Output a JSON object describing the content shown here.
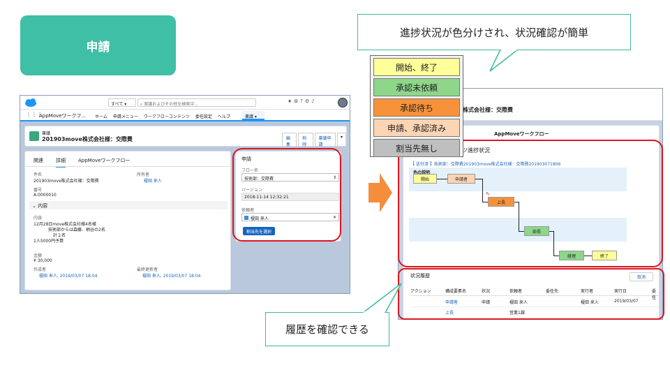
{
  "badge": {
    "label": "申請"
  },
  "callout_top": {
    "text": "進捗状況が色分けされ、状況確認が簡単"
  },
  "callout_bottom": {
    "text": "履歴を確認できる"
  },
  "legend": {
    "items": [
      {
        "label": "開始、終了",
        "color": "#ffff99"
      },
      {
        "label": "承認未依頼",
        "color": "#8ed68a"
      },
      {
        "label": "承認待ち",
        "color": "#f7923a"
      },
      {
        "label": "申請、承認済み",
        "color": "#fcd5b4"
      },
      {
        "label": "割当先無し",
        "color": "#bfbfbf"
      }
    ]
  },
  "left": {
    "search": {
      "scope": "すべて",
      "placeholder": "案議およびその他を検索中..."
    },
    "nav": {
      "app": "AppMoveワークフ...",
      "items": [
        "ホーム",
        "申請メニュー",
        "ワークフローコンテンツ",
        "委任設定",
        "ヘルプ"
      ],
      "active": "稟議"
    },
    "record": {
      "type": "稟議",
      "title": "201903move株式会社様：交際費",
      "actions": [
        "編集",
        "削除",
        "稟議申請"
      ]
    },
    "tabs": [
      "関連",
      "詳細",
      "AppMoveワークフロー"
    ],
    "active_tab": "詳細",
    "fields": {
      "name_label": "件名",
      "name_value": "201903move株式会社様：交際費",
      "owner_label": "所有者",
      "owner_value": "榎田 来人",
      "number_label": "番号",
      "number_value": "A-0000010",
      "section": "内容",
      "content_label": "内容",
      "content_lines": [
        "12月28日move株式会社様4名様",
        "技術部からは森藤、柄谷の2名",
        "計２名",
        "1人5000円予算"
      ],
      "amount_label": "金額",
      "amount_value": "¥ 30,000",
      "creator_label": "作成者",
      "creator_value": "榎田 来人, 2019/03/07 18:04",
      "modifier_label": "最終更新者",
      "modifier_value": "榎田 来人, 2019/03/07 18:04"
    },
    "apply_panel": {
      "title": "申請",
      "flow_label": "フロー名",
      "flow_value": "技術部：交際費",
      "version_label": "バージョン",
      "version_value": "2018-11-14 12:32:21",
      "approver_label": "依頼者",
      "approver_value": "榎田 来人",
      "button": "割当先を選択"
    }
  },
  "right": {
    "title": "株式会社様：交際費",
    "section_title": "AppMoveワークフロー",
    "progress_title": "ツ進捗状況",
    "path": "【 送付済 】技術部：交際費201903move株式会社様：交際費201903071806",
    "legend_label": "色の説明",
    "nodes": [
      "開始",
      "申請者",
      "上長",
      "部長",
      "経理",
      "終了"
    ],
    "history_title": "状況履歴",
    "cancel": "取消",
    "columns": [
      "アクション",
      "構成要素名",
      "状況",
      "依頼者",
      "委任先",
      "実行者",
      "実行日",
      "委任"
    ],
    "rows": [
      [
        "",
        "申請者",
        "申請",
        "榎田 来人",
        "",
        "榎田 来人",
        "2019/03/07",
        ""
      ],
      [
        "",
        "上長",
        "",
        "営業1課",
        "",
        "",
        "",
        ""
      ]
    ]
  }
}
